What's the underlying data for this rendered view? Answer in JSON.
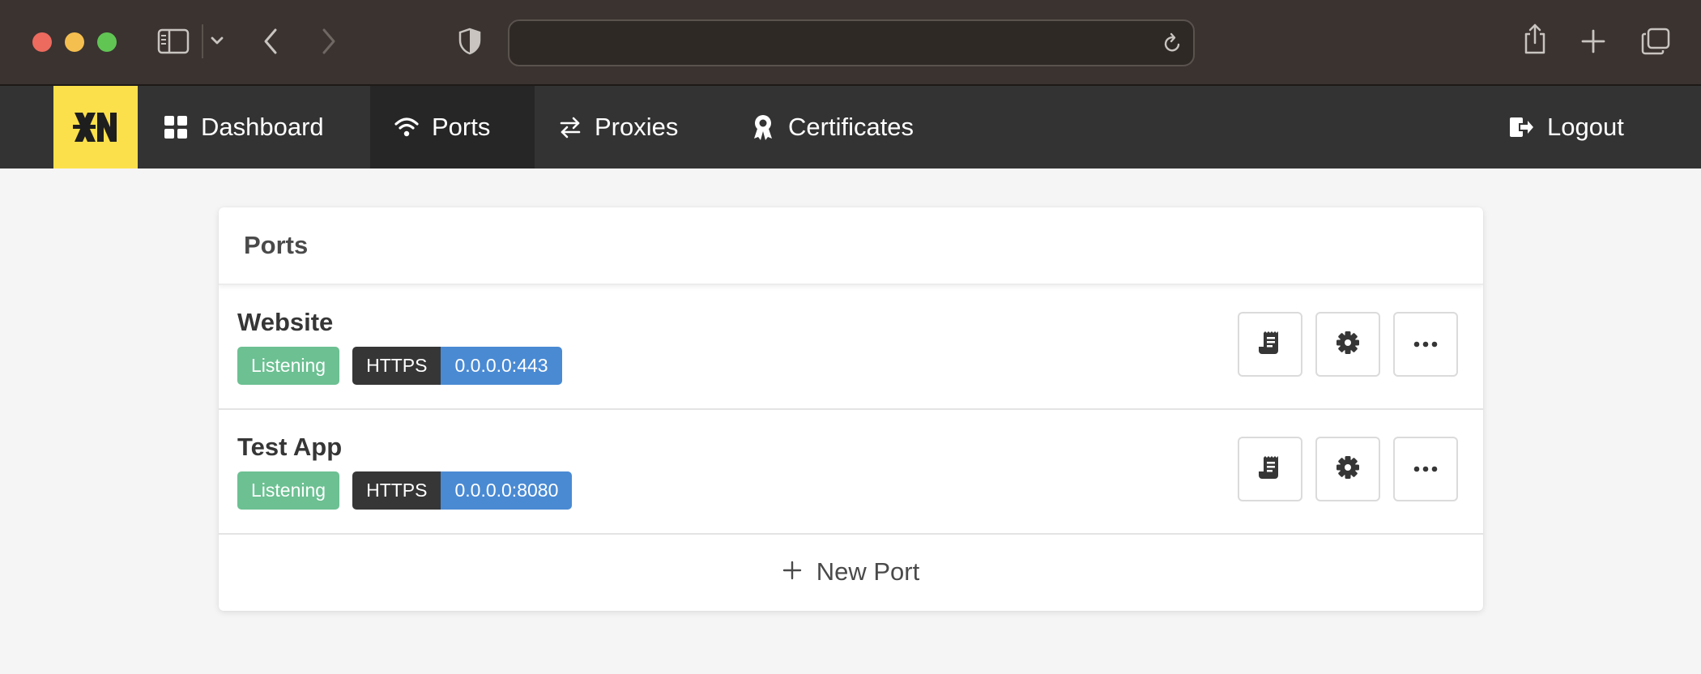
{
  "browser": {
    "icons": [
      "sidebar-icon",
      "chevron-down-icon",
      "back-icon",
      "forward-icon",
      "shield-icon",
      "reload-icon",
      "share-icon",
      "new-tab-icon",
      "tabs-overview-icon"
    ],
    "address": ""
  },
  "nav": {
    "logo_icon": "app-logo-icon",
    "items": [
      {
        "label": "Dashboard",
        "icon": "dashboard-icon",
        "active": false
      },
      {
        "label": "Ports",
        "icon": "wifi-icon",
        "active": true
      },
      {
        "label": "Proxies",
        "icon": "arrows-swap-icon",
        "active": false
      },
      {
        "label": "Certificates",
        "icon": "certificate-icon",
        "active": false
      }
    ],
    "logout": {
      "label": "Logout",
      "icon": "logout-icon"
    }
  },
  "card": {
    "title": "Ports",
    "ports": [
      {
        "name": "Website",
        "status": "Listening",
        "protocol": "HTTPS",
        "address": "0.0.0.0:443"
      },
      {
        "name": "Test App",
        "status": "Listening",
        "protocol": "HTTPS",
        "address": "0.0.0.0:8080"
      }
    ],
    "new_port_label": "New Port"
  },
  "colors": {
    "accent": "#fce04b",
    "nav_bg": "#333333",
    "status_green": "#6cc092",
    "address_blue": "#4a8ad3",
    "protocol_dark": "#363636"
  }
}
